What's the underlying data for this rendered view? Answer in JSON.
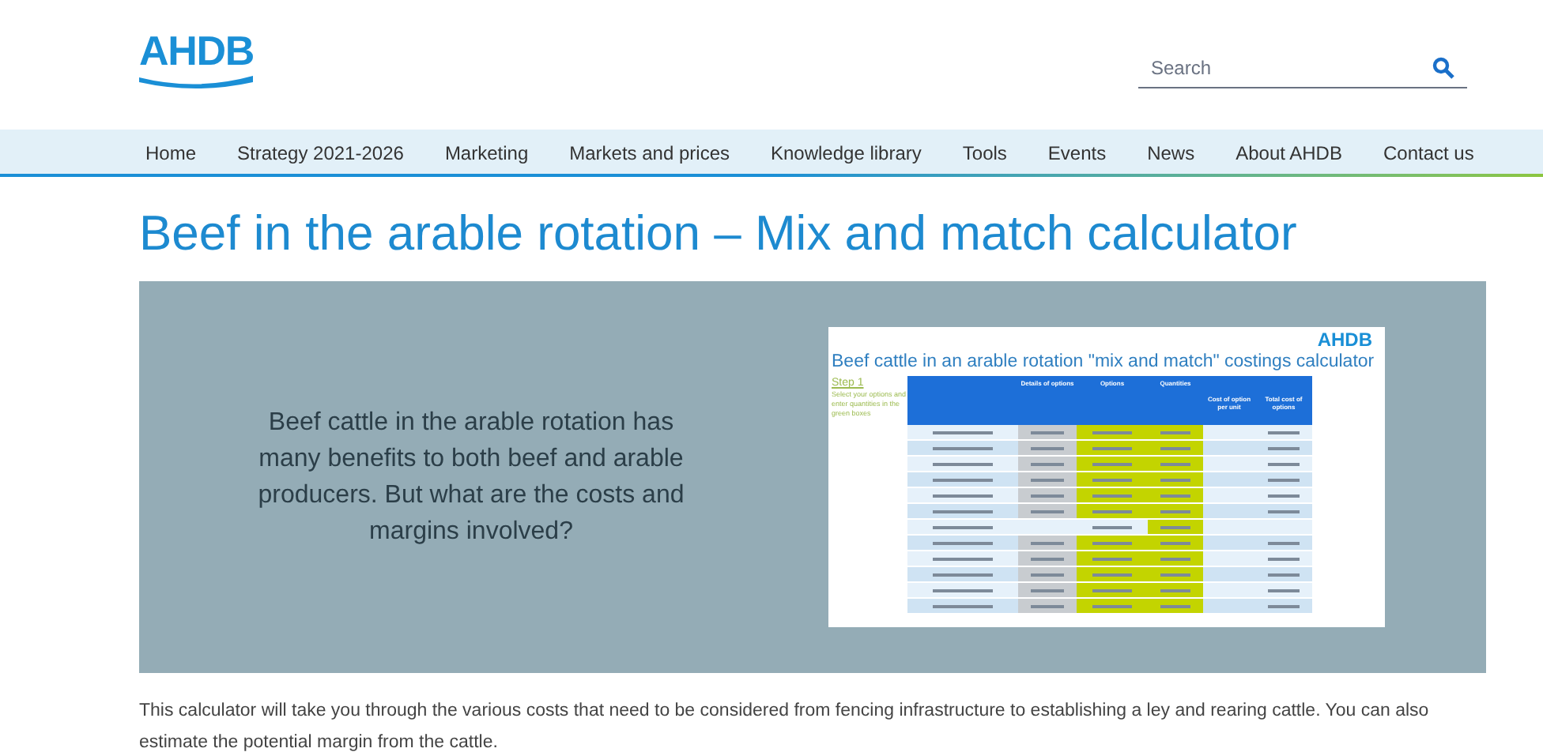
{
  "logo": "AHDB",
  "search": {
    "placeholder": "Search"
  },
  "nav": [
    {
      "label": "Home"
    },
    {
      "label": "Strategy 2021-2026"
    },
    {
      "label": "Marketing"
    },
    {
      "label": "Markets and prices"
    },
    {
      "label": "Knowledge library"
    },
    {
      "label": "Tools"
    },
    {
      "label": "Events"
    },
    {
      "label": "News"
    },
    {
      "label": "About AHDB"
    },
    {
      "label": "Contact us"
    }
  ],
  "title": "Beef in the arable rotation – Mix and match calculator",
  "banner": {
    "text": "Beef cattle in the arable rotation has many benefits to both beef and arable producers. But what are the costs and margins involved?",
    "preview": {
      "logo": "AHDB",
      "title": "Beef cattle in an arable rotation \"mix and match\" costings calculator",
      "step": "Step 1",
      "step_text": "Select your options and enter quantities in the green boxes",
      "columns": [
        "Details of options",
        "Options",
        "Quantities",
        "Cost of option per unit",
        "Total cost of options"
      ],
      "rows": [
        {
          "kind": "select"
        },
        {
          "kind": "select"
        },
        {
          "kind": "select"
        },
        {
          "kind": "select"
        },
        {
          "kind": "select"
        },
        {
          "kind": "select"
        },
        {
          "kind": "entry"
        },
        {
          "kind": "select"
        },
        {
          "kind": "select"
        },
        {
          "kind": "select"
        },
        {
          "kind": "select"
        },
        {
          "kind": "select"
        }
      ]
    }
  },
  "intro": "This calculator will take you through the various costs that need to be considered from fencing infrastructure to establishing a ley and rearing cattle. You can also estimate the potential margin from the cattle."
}
